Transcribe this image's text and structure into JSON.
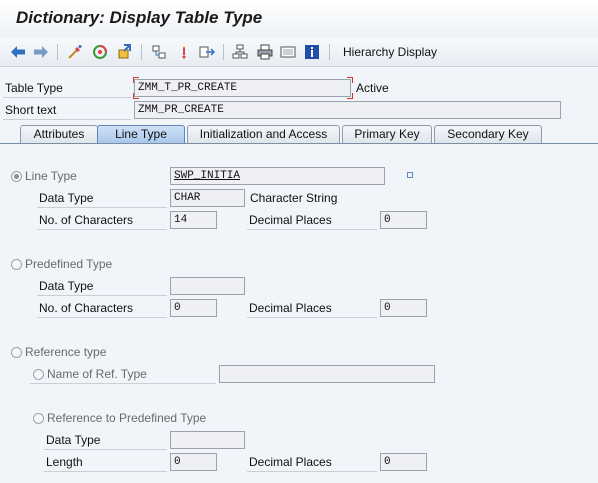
{
  "window": {
    "title": "Dictionary: Display Table Type"
  },
  "toolbar": {
    "icons": [
      "back-arrow-icon",
      "forward-arrow-icon",
      "other-object-icon",
      "display-change-icon",
      "activate-icon",
      "where-used-icon",
      "technical-settings-icon",
      "navigation-icon",
      "hierarchy-icon",
      "print-icon",
      "display-object-list-icon",
      "information-icon"
    ],
    "hierarchy_label": "Hierarchy Display"
  },
  "header": {
    "table_type_label": "Table Type",
    "table_type_value": "ZMM_T_PR_CREATE",
    "status": "Active",
    "short_text_label": "Short text",
    "short_text_value": "ZMM_PR_CREATE"
  },
  "tabs": [
    {
      "label": "Attributes",
      "active": false
    },
    {
      "label": "Line Type",
      "active": true
    },
    {
      "label": "Initialization and Access",
      "active": false
    },
    {
      "label": "Primary Key",
      "active": false
    },
    {
      "label": "Secondary Key",
      "active": false
    }
  ],
  "line_type": {
    "label": "Line Type",
    "value": "SWP_INITIA",
    "data_type_label": "Data Type",
    "data_type_value": "CHAR",
    "data_type_desc": "Character String",
    "no_chars_label": "No. of Characters",
    "no_chars_value": "14",
    "decimal_label": "Decimal Places",
    "decimal_value": "0"
  },
  "predefined": {
    "label": "Predefined Type",
    "data_type_label": "Data Type",
    "data_type_value": "",
    "no_chars_label": "No. of Characters",
    "no_chars_value": "0",
    "decimal_label": "Decimal Places",
    "decimal_value": "0"
  },
  "reference": {
    "label": "Reference type",
    "name_ref_label": "Name of Ref. Type",
    "name_ref_value": "",
    "ref_predef_label": "Reference to Predefined Type",
    "data_type_label": "Data Type",
    "data_type_value": "",
    "length_label": "Length",
    "length_value": "0",
    "decimal_label": "Decimal Places",
    "decimal_value": "0"
  },
  "colors": {
    "title": "#1a1a1a",
    "active_tab": "#a9c8ea",
    "marker": "#d2352a"
  }
}
